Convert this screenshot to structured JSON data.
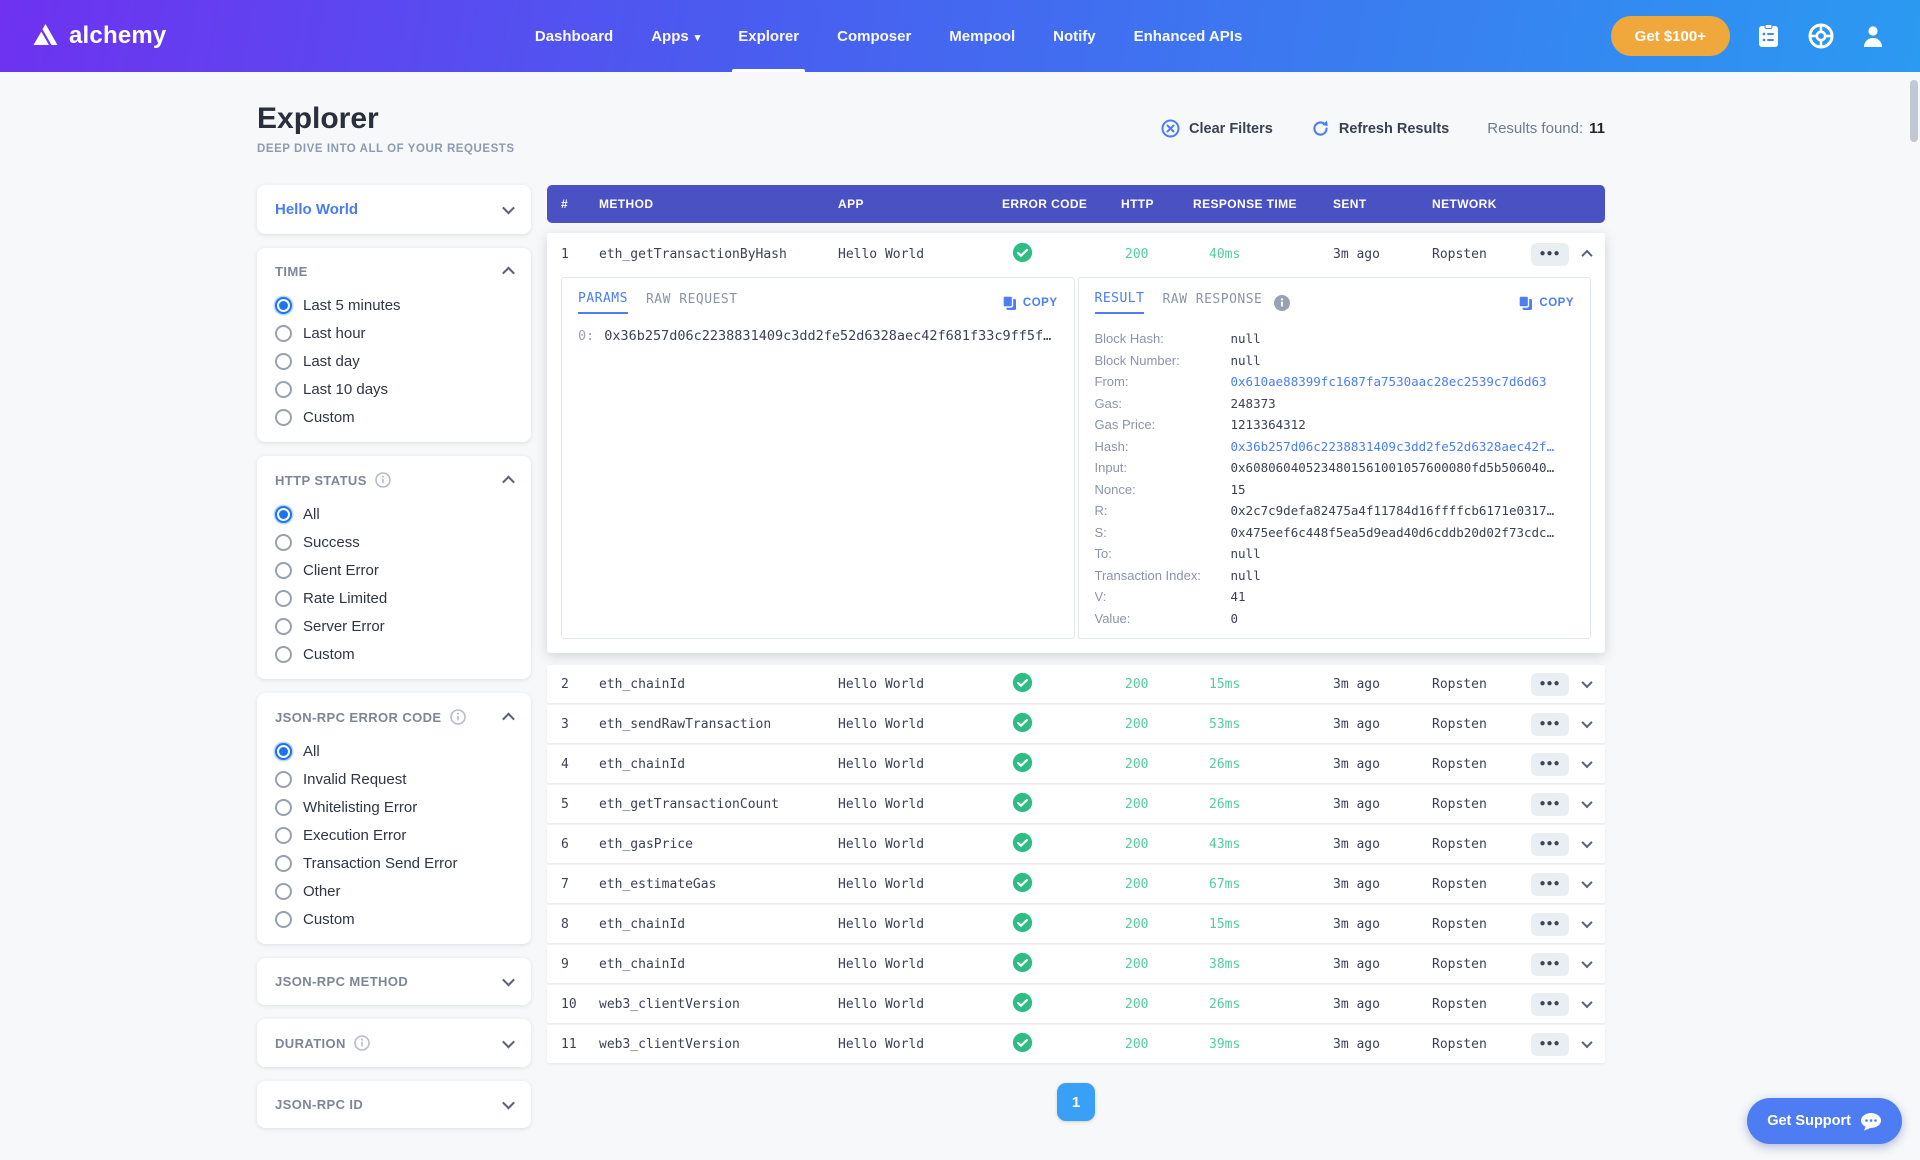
{
  "brand": {
    "name": "alchemy"
  },
  "nav": {
    "items": [
      {
        "label": "Dashboard"
      },
      {
        "label": "Apps",
        "caret": true
      },
      {
        "label": "Explorer",
        "active": true
      },
      {
        "label": "Composer"
      },
      {
        "label": "Mempool"
      },
      {
        "label": "Notify"
      },
      {
        "label": "Enhanced APIs"
      }
    ],
    "cta": "Get $100+"
  },
  "header": {
    "title": "Explorer",
    "subtitle": "DEEP DIVE INTO ALL OF YOUR REQUESTS",
    "clear_filters": "Clear Filters",
    "refresh_results": "Refresh Results",
    "results_found_label": "Results found:",
    "results_found_value": "11"
  },
  "sidebar": {
    "app_filter": {
      "value": "Hello World"
    },
    "sections": [
      {
        "title": "TIME",
        "expanded": true,
        "options": [
          {
            "label": "Last 5 minutes",
            "selected": true
          },
          {
            "label": "Last hour"
          },
          {
            "label": "Last day"
          },
          {
            "label": "Last 10 days"
          },
          {
            "label": "Custom"
          }
        ]
      },
      {
        "title": "HTTP STATUS",
        "expanded": true,
        "has_info": true,
        "options": [
          {
            "label": "All",
            "selected": true
          },
          {
            "label": "Success"
          },
          {
            "label": "Client Error"
          },
          {
            "label": "Rate Limited"
          },
          {
            "label": "Server Error"
          },
          {
            "label": "Custom"
          }
        ]
      },
      {
        "title": "JSON-RPC ERROR CODE",
        "expanded": true,
        "has_info": true,
        "options": [
          {
            "label": "All",
            "selected": true
          },
          {
            "label": "Invalid Request"
          },
          {
            "label": "Whitelisting Error"
          },
          {
            "label": "Execution Error"
          },
          {
            "label": "Transaction Send Error"
          },
          {
            "label": "Other"
          },
          {
            "label": "Custom"
          }
        ]
      },
      {
        "title": "JSON-RPC METHOD",
        "expanded": false
      },
      {
        "title": "DURATION",
        "expanded": false,
        "has_info": true
      },
      {
        "title": "JSON-RPC ID",
        "expanded": false
      }
    ]
  },
  "table": {
    "columns": [
      "#",
      "METHOD",
      "APP",
      "ERROR CODE",
      "HTTP",
      "RESPONSE TIME",
      "SENT",
      "NETWORK"
    ],
    "expanded_row": {
      "num": "1",
      "method": "eth_getTransactionByHash",
      "app": "Hello World",
      "http": "200",
      "time": "40ms",
      "sent": "3m ago",
      "network": "Ropsten"
    },
    "detail": {
      "request": {
        "tabs": [
          "PARAMS",
          "RAW REQUEST"
        ],
        "copy_label": "COPY",
        "param_key": "0:",
        "param_value": "0x36b257d06c2238831409c3dd2fe52d6328aec42f681f33c9ff5f…"
      },
      "response": {
        "tabs": [
          "RESULT",
          "RAW RESPONSE"
        ],
        "copy_label": "COPY",
        "fields": [
          {
            "label": "Block Hash:",
            "value": "null"
          },
          {
            "label": "Block Number:",
            "value": "null"
          },
          {
            "label": "From:",
            "value": "0x610ae88399fc1687fa7530aac28ec2539c7d6d63",
            "link": true
          },
          {
            "label": "Gas:",
            "value": "248373"
          },
          {
            "label": "Gas Price:",
            "value": "1213364312"
          },
          {
            "label": "Hash:",
            "value": "0x36b257d06c2238831409c3dd2fe52d6328aec42f…",
            "link": true
          },
          {
            "label": "Input:",
            "value": "0x608060405234801561001057600080fd5b506040…"
          },
          {
            "label": "Nonce:",
            "value": "15"
          },
          {
            "label": "R:",
            "value": "0x2c7c9defa82475a4f11784d16ffffcb6171e0317…"
          },
          {
            "label": "S:",
            "value": "0x475eef6c448f5ea5d9ead40d6cddb20d02f73cdc…"
          },
          {
            "label": "To:",
            "value": "null"
          },
          {
            "label": "Transaction Index:",
            "value": "null"
          },
          {
            "label": "V:",
            "value": "41"
          },
          {
            "label": "Value:",
            "value": "0"
          }
        ]
      }
    },
    "rows": [
      {
        "num": "2",
        "method": "eth_chainId",
        "app": "Hello World",
        "http": "200",
        "time": "15ms",
        "sent": "3m ago",
        "network": "Ropsten"
      },
      {
        "num": "3",
        "method": "eth_sendRawTransaction",
        "app": "Hello World",
        "http": "200",
        "time": "53ms",
        "sent": "3m ago",
        "network": "Ropsten"
      },
      {
        "num": "4",
        "method": "eth_chainId",
        "app": "Hello World",
        "http": "200",
        "time": "26ms",
        "sent": "3m ago",
        "network": "Ropsten"
      },
      {
        "num": "5",
        "method": "eth_getTransactionCount",
        "app": "Hello World",
        "http": "200",
        "time": "26ms",
        "sent": "3m ago",
        "network": "Ropsten"
      },
      {
        "num": "6",
        "method": "eth_gasPrice",
        "app": "Hello World",
        "http": "200",
        "time": "43ms",
        "sent": "3m ago",
        "network": "Ropsten"
      },
      {
        "num": "7",
        "method": "eth_estimateGas",
        "app": "Hello World",
        "http": "200",
        "time": "67ms",
        "sent": "3m ago",
        "network": "Ropsten"
      },
      {
        "num": "8",
        "method": "eth_chainId",
        "app": "Hello World",
        "http": "200",
        "time": "15ms",
        "sent": "3m ago",
        "network": "Ropsten"
      },
      {
        "num": "9",
        "method": "eth_chainId",
        "app": "Hello World",
        "http": "200",
        "time": "38ms",
        "sent": "3m ago",
        "network": "Ropsten"
      },
      {
        "num": "10",
        "method": "web3_clientVersion",
        "app": "Hello World",
        "http": "200",
        "time": "26ms",
        "sent": "3m ago",
        "network": "Ropsten"
      },
      {
        "num": "11",
        "method": "web3_clientVersion",
        "app": "Hello World",
        "http": "200",
        "time": "39ms",
        "sent": "3m ago",
        "network": "Ropsten"
      }
    ],
    "pagination": {
      "page": "1"
    }
  },
  "support": {
    "label": "Get Support"
  }
}
